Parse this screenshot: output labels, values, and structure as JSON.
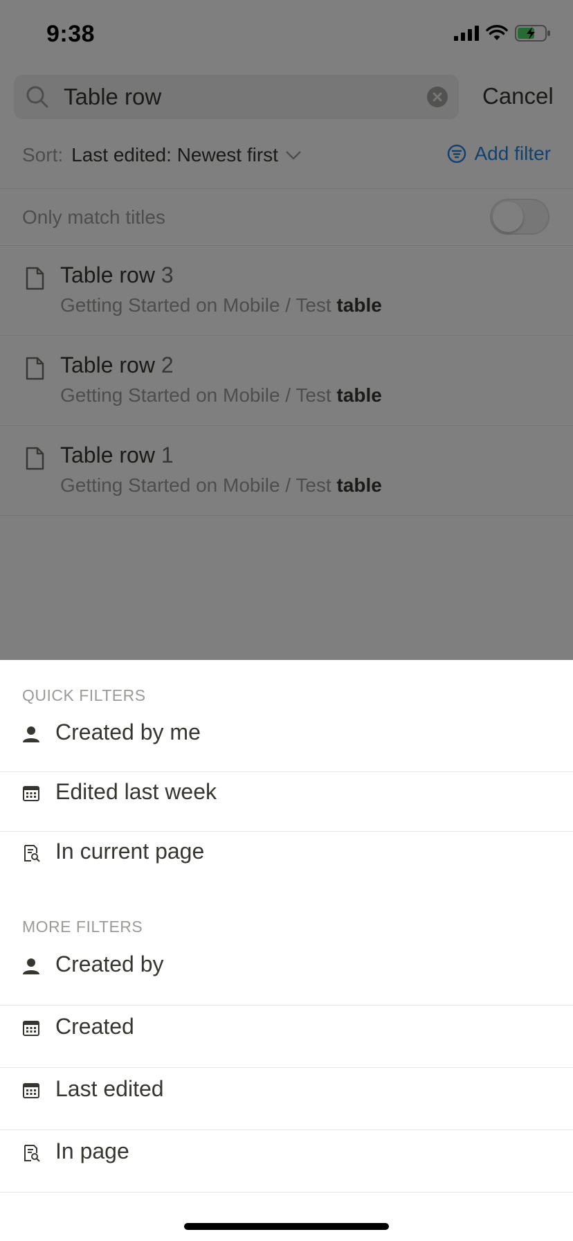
{
  "status_bar": {
    "time": "9:38"
  },
  "search": {
    "value": "Table row",
    "cancel_label": "Cancel"
  },
  "sort": {
    "label": "Sort:",
    "value": "Last edited: Newest first"
  },
  "add_filter_label": "Add filter",
  "only_match_titles": {
    "label": "Only match titles",
    "on": false
  },
  "results": [
    {
      "title": "Table row",
      "number": "3",
      "path": "Getting Started on Mobile / Test",
      "match": "table"
    },
    {
      "title": "Table row",
      "number": "2",
      "path": "Getting Started on Mobile / Test",
      "match": "table"
    },
    {
      "title": "Table row",
      "number": "1",
      "path": "Getting Started on Mobile / Test",
      "match": "table"
    }
  ],
  "quick_filters": {
    "header": "QUICK FILTERS",
    "items": [
      {
        "label": "Created by me",
        "icon": "person-icon"
      },
      {
        "label": "Edited last week",
        "icon": "calendar-icon"
      },
      {
        "label": "In current page",
        "icon": "page-search-icon"
      }
    ]
  },
  "more_filters": {
    "header": "MORE FILTERS",
    "items": [
      {
        "label": "Created by",
        "icon": "person-icon"
      },
      {
        "label": "Created",
        "icon": "calendar-icon"
      },
      {
        "label": "Last edited",
        "icon": "calendar-icon"
      },
      {
        "label": "In page",
        "icon": "page-search-icon"
      }
    ]
  },
  "colors": {
    "accent": "#2383e2",
    "text": "#37352f",
    "muted": "#9b9a97",
    "battery": "#4cd964"
  }
}
